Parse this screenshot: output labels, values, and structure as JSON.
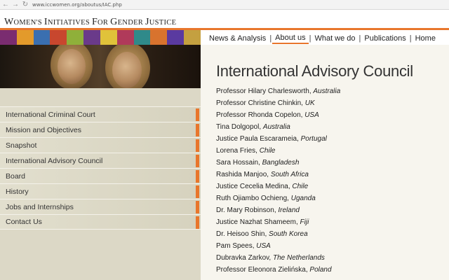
{
  "browser": {
    "url": "www.iccwomen.org/aboutus/IAC.php"
  },
  "header": {
    "title_parts": [
      {
        "big": "W",
        "small": "OMEN'S "
      },
      {
        "big": "I",
        "small": "NITIATIVES "
      },
      {
        "big": "F",
        "small": "OR "
      },
      {
        "big": "G",
        "small": "ENDER "
      },
      {
        "big": "J",
        "small": "USTICE"
      }
    ]
  },
  "top_nav": {
    "items": [
      "News & Analysis",
      "About us",
      "What we do",
      "Publications",
      "Home"
    ],
    "active": "About us"
  },
  "sidebar": {
    "items": [
      "International Criminal Court",
      "Mission and Objectives",
      "Snapshot",
      "International Advisory Council",
      "Board",
      "History",
      "Jobs and Internships",
      "Contact Us"
    ]
  },
  "colors": {
    "accent": "#e8762c",
    "sidebar_bg": "#dcd8c6",
    "content_bg": "#f7f5ee"
  },
  "main": {
    "title": "International Advisory Council",
    "members": [
      {
        "name": "Professor Hilary Charlesworth",
        "country": "Australia"
      },
      {
        "name": "Professor Christine Chinkin",
        "country": "UK"
      },
      {
        "name": "Professor Rhonda Copelon",
        "country": "USA"
      },
      {
        "name": "Tina Dolgopol",
        "country": "Australia"
      },
      {
        "name": "Justice Paula Escarameia",
        "country": "Portugal"
      },
      {
        "name": "Lorena Fries",
        "country": "Chile"
      },
      {
        "name": "Sara Hossain",
        "country": "Bangladesh"
      },
      {
        "name": "Rashida Manjoo",
        "country": "South Africa"
      },
      {
        "name": "Justice Cecelia Medina",
        "country": "Chile"
      },
      {
        "name": "Ruth Ojiambo Ochieng",
        "country": "Uganda"
      },
      {
        "name": "Dr. Mary Robinson",
        "country": "Ireland"
      },
      {
        "name": "Justice Nazhat Shameem",
        "country": "Fiji"
      },
      {
        "name": "Dr. Heisoo Shin",
        "country": "South Korea"
      },
      {
        "name": "Pam Spees",
        "country": "USA"
      },
      {
        "name": "Dubravka Zarkov",
        "country": "The Netherlands"
      },
      {
        "name": "Professor Eleonora Zielińska",
        "country": "Poland"
      }
    ]
  }
}
